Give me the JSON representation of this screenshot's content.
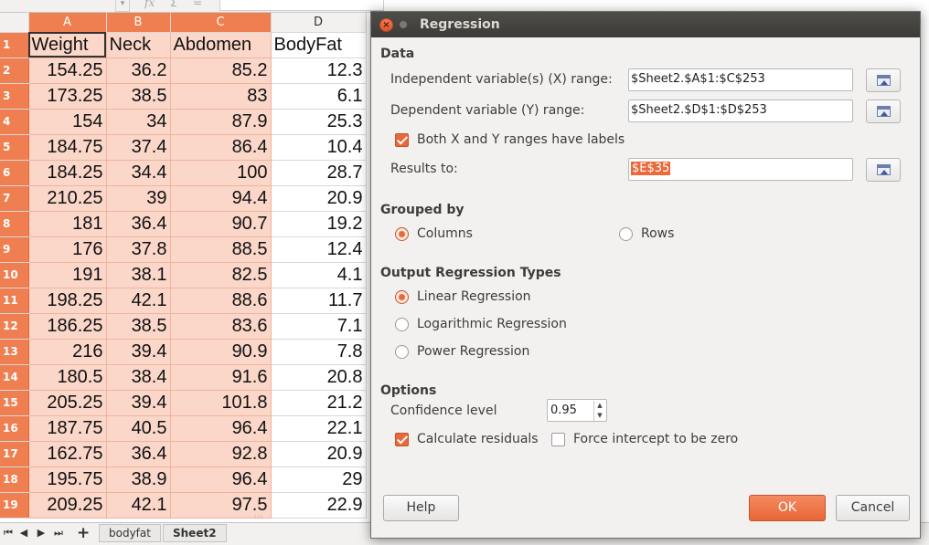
{
  "spreadsheet": {
    "column_headers": [
      "A",
      "B",
      "C",
      "D"
    ],
    "row_numbers": [
      "1",
      "2",
      "3",
      "4",
      "5",
      "6",
      "7",
      "8",
      "9",
      "10",
      "11",
      "12",
      "13",
      "14",
      "15",
      "16",
      "17",
      "18",
      "19"
    ],
    "header_row": [
      "Weight",
      "Neck",
      "Abdomen",
      "BodyFat"
    ],
    "rows": [
      [
        "154.25",
        "36.2",
        "85.2",
        "12.3"
      ],
      [
        "173.25",
        "38.5",
        "83",
        "6.1"
      ],
      [
        "154",
        "34",
        "87.9",
        "25.3"
      ],
      [
        "184.75",
        "37.4",
        "86.4",
        "10.4"
      ],
      [
        "184.25",
        "34.4",
        "100",
        "28.7"
      ],
      [
        "210.25",
        "39",
        "94.4",
        "20.9"
      ],
      [
        "181",
        "36.4",
        "90.7",
        "19.2"
      ],
      [
        "176",
        "37.8",
        "88.5",
        "12.4"
      ],
      [
        "191",
        "38.1",
        "82.5",
        "4.1"
      ],
      [
        "198.25",
        "42.1",
        "88.6",
        "11.7"
      ],
      [
        "186.25",
        "38.5",
        "83.6",
        "7.1"
      ],
      [
        "216",
        "39.4",
        "90.9",
        "7.8"
      ],
      [
        "180.5",
        "38.4",
        "91.6",
        "20.8"
      ],
      [
        "205.25",
        "39.4",
        "101.8",
        "21.2"
      ],
      [
        "187.75",
        "40.5",
        "96.4",
        "22.1"
      ],
      [
        "162.75",
        "36.4",
        "92.8",
        "20.9"
      ],
      [
        "195.75",
        "38.9",
        "96.4",
        "29"
      ],
      [
        "209.25",
        "42.1",
        "97.5",
        "22.9"
      ]
    ],
    "formula_bar": {
      "fx": "fx",
      "sum": "Σ",
      "equals": "="
    },
    "sheet_tabs": [
      "bodyfat",
      "Sheet2"
    ],
    "active_tab": "Sheet2",
    "add_sheet": "+"
  },
  "dialog": {
    "title": "Regression",
    "close_glyph": "×",
    "data_section": {
      "heading": "Data",
      "independent_label": "Independent variable(s) (X) range:",
      "independent_value": "$Sheet2.$A$1:$C$253",
      "dependent_label": "Dependent variable (Y) range:",
      "dependent_value": "$Sheet2.$D$1:$D$253",
      "labels_checkbox": "Both X and Y ranges have labels",
      "labels_checked": true,
      "results_label": "Results to:",
      "results_value": "$E$35"
    },
    "grouped_by": {
      "heading": "Grouped by",
      "columns": "Columns",
      "rows": "Rows",
      "selected": "Columns"
    },
    "output_types": {
      "heading": "Output Regression Types",
      "linear": "Linear Regression",
      "logarithmic": "Logarithmic Regression",
      "power": "Power Regression",
      "selected": "Linear Regression"
    },
    "options": {
      "heading": "Options",
      "confidence_label": "Confidence level",
      "confidence_value": "0.95",
      "residuals_label": "Calculate residuals",
      "residuals_checked": true,
      "force_intercept_label": "Force intercept to be zero",
      "force_intercept_checked": false
    },
    "buttons": {
      "help": "Help",
      "ok": "OK",
      "cancel": "Cancel"
    }
  },
  "colors": {
    "accent": "#e9693b",
    "selection_fill": "#fbd7c9",
    "header_orange": "#ef7f50",
    "titlebar": "#3c3b37"
  }
}
